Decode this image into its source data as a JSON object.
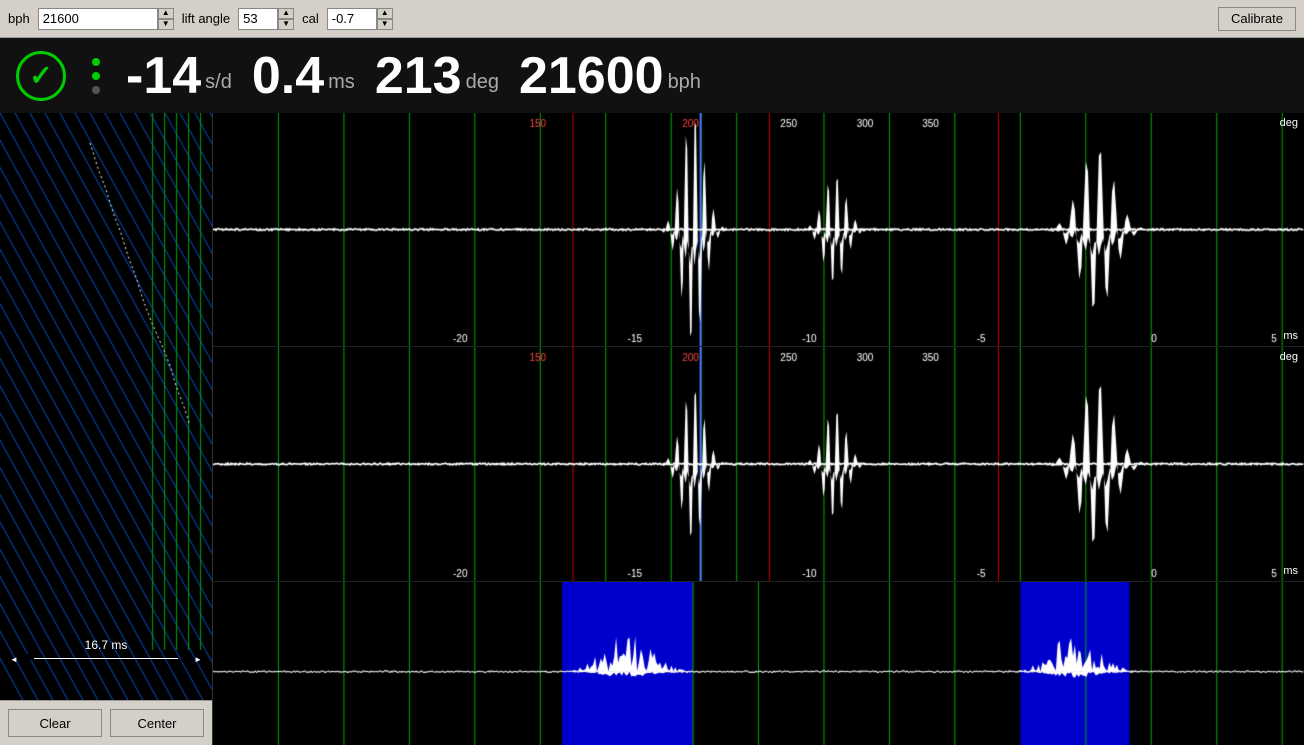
{
  "toolbar": {
    "bph_label": "bph",
    "bph_value": "21600",
    "lift_angle_label": "lift angle",
    "lift_angle_value": "53",
    "cal_label": "cal",
    "cal_value": "-0.7",
    "calibrate_label": "Calibrate"
  },
  "status": {
    "rate": "-14",
    "rate_unit": "s/d",
    "ms": "0.4",
    "ms_unit": "ms",
    "deg": "213",
    "deg_unit": "deg",
    "bph": "21600",
    "bph_unit": "bph"
  },
  "timestrip": {
    "duration_label": "16.7 ms"
  },
  "buttons": {
    "clear": "Clear",
    "center": "Center"
  },
  "charts": [
    {
      "id": "chart1",
      "show_deg": true,
      "show_ms": true
    },
    {
      "id": "chart2",
      "show_deg": true,
      "show_ms": true
    },
    {
      "id": "chart3",
      "show_deg": false,
      "show_ms": false
    }
  ],
  "deg_ticks": [
    "150",
    "200",
    "250",
    "300",
    "350"
  ],
  "ms_ticks": [
    "-20",
    "-15",
    "-10",
    "-5",
    "0",
    "5"
  ]
}
